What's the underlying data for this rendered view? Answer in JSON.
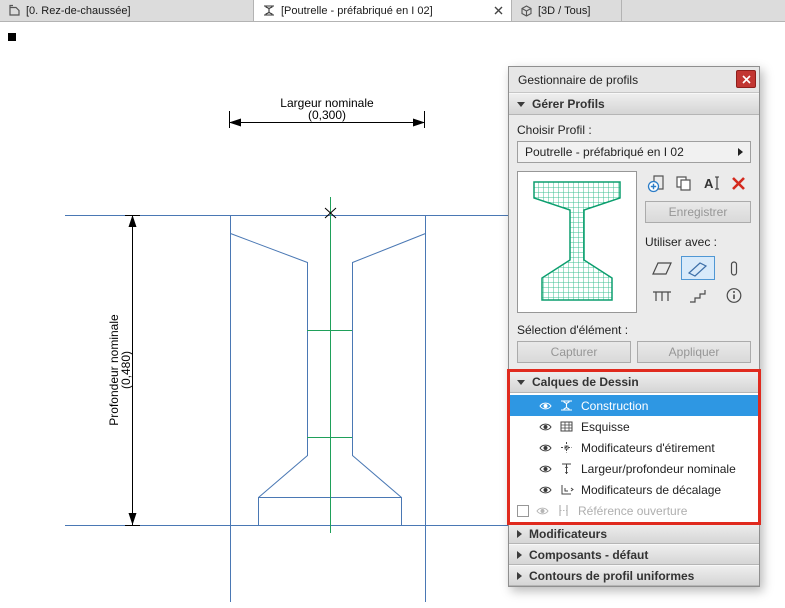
{
  "window": {
    "tabs": [
      {
        "label": "[0. Rez-de-chaussée]"
      },
      {
        "label": "[Poutrelle - préfabriqué en I 02]"
      },
      {
        "label": "[3D / Tous]"
      }
    ]
  },
  "drawing": {
    "width_label": "Largeur nominale",
    "width_value": "(0,300)",
    "depth_label": "Profondeur nominale",
    "depth_value": "(0,480)"
  },
  "panel": {
    "title": "Gestionnaire de profils",
    "manage_section": "Gérer Profils",
    "choose_profile_label": "Choisir Profil :",
    "profile_name": "Poutrelle - préfabriqué en I 02",
    "save_button": "Enregistrer",
    "use_with_label": "Utiliser avec :",
    "element_selection_label": "Sélection d'élément :",
    "capture_button": "Capturer",
    "apply_button": "Appliquer",
    "layers_section": "Calques de Dessin",
    "layers": [
      {
        "label": "Construction",
        "selected": true
      },
      {
        "label": "Esquisse"
      },
      {
        "label": "Modificateurs d'étirement"
      },
      {
        "label": "Largeur/profondeur nominale"
      },
      {
        "label": "Modificateurs de décalage"
      },
      {
        "label": "Référence ouverture",
        "disabled": true,
        "checkbox_checked": false
      }
    ],
    "collapsed_sections": [
      {
        "label": "Modificateurs"
      },
      {
        "label": "Composants - défaut"
      },
      {
        "label": "Contours de profil uniformes"
      }
    ]
  },
  "icons": {
    "rename_glyph": "A",
    "section_expanded": "▼",
    "section_collapsed": "▶",
    "dropdown_arrow": "▶",
    "close": "✕"
  },
  "colors": {
    "selection_blue": "#2e97e3",
    "annotation_red": "#e02a1e",
    "close_button_red": "#c23632",
    "drawing_outline_blue": "#4a78b4",
    "drawing_centerline_green": "#1fa05a",
    "preview_profile_green": "#0b9e6e"
  }
}
